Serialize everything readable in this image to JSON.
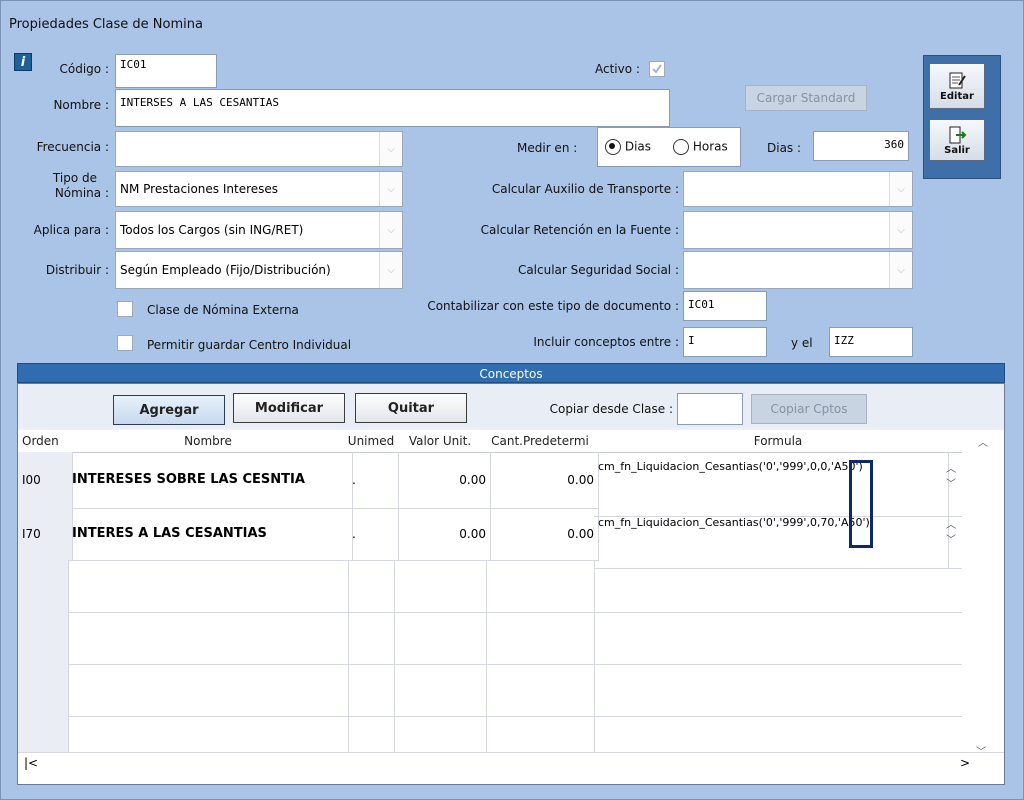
{
  "window": {
    "title": "Propiedades Clase de Nomina"
  },
  "form": {
    "codigo_label": "Código :",
    "codigo_value": "IC01",
    "activo_label": "Activo :",
    "nombre_label": "Nombre :",
    "nombre_value": "INTERSES A LAS CESANTIAS",
    "cargar_standard": "Cargar Standard",
    "frecuencia_label": "Frecuencia :",
    "frecuencia_value": "",
    "medir_label": "Medir en :",
    "radio_dias": "Dias",
    "radio_horas": "Horas",
    "dias_label": "Dias :",
    "dias_value": "360",
    "tipo_label_1": "Tipo de",
    "tipo_label_2": "Nómina :",
    "tipo_value": "NM Prestaciones Intereses",
    "aux_label": "Calcular Auxilio de Transporte :",
    "aplica_label": "Aplica para :",
    "aplica_value": "Todos los Cargos (sin ING/RET)",
    "ret_label": "Calcular Retención en la Fuente :",
    "distribuir_label": "Distribuir :",
    "distribuir_value": "Según Empleado (Fijo/Distribución)",
    "seg_label": "Calcular Seguridad Social :",
    "externa_label": "Clase de Nómina Externa",
    "conta_label": "Contabilizar con este tipo de documento :",
    "conta_value": "IC01",
    "permitir_label": "Permitir guardar Centro Individual",
    "incluir_label": "Incluir conceptos entre :",
    "incluir_from": "I",
    "yel_label": "y el",
    "incluir_to": "IZZ"
  },
  "side": {
    "editar": "Editar",
    "salir": "Salir"
  },
  "conceptos": {
    "title": "Conceptos",
    "agregar": "Agregar",
    "modificar": "Modificar",
    "quitar": "Quitar",
    "copiar_label": "Copiar desde Clase :",
    "copiar_value": "",
    "copiar_btn": "Copiar Cptos"
  },
  "table": {
    "headers": [
      "Orden",
      "Nombre",
      "Unimed",
      "Valor Unit.",
      "Cant.Predetermi",
      "Formula"
    ],
    "rows": [
      {
        "orden": "I00",
        "nombre": "INTERESES SOBRE LAS CESNTIA",
        "unimed": ".",
        "valor": "0.00",
        "cant": "0.00",
        "formula": "cm_fn_Liquidacion_Cesantias('0','999',0,0,'A50')"
      },
      {
        "orden": "I70",
        "nombre": "INTERES A LAS CESANTIAS",
        "unimed": ".",
        "valor": "0.00",
        "cant": "0.00",
        "formula": "cm_fn_Liquidacion_Cesantias('0','999',0,70,'A50')"
      }
    ]
  },
  "colors": {
    "window_bg": "#a9c4e6",
    "section_bar": "#2f6cb0",
    "highlight": "#0a2a6b"
  }
}
